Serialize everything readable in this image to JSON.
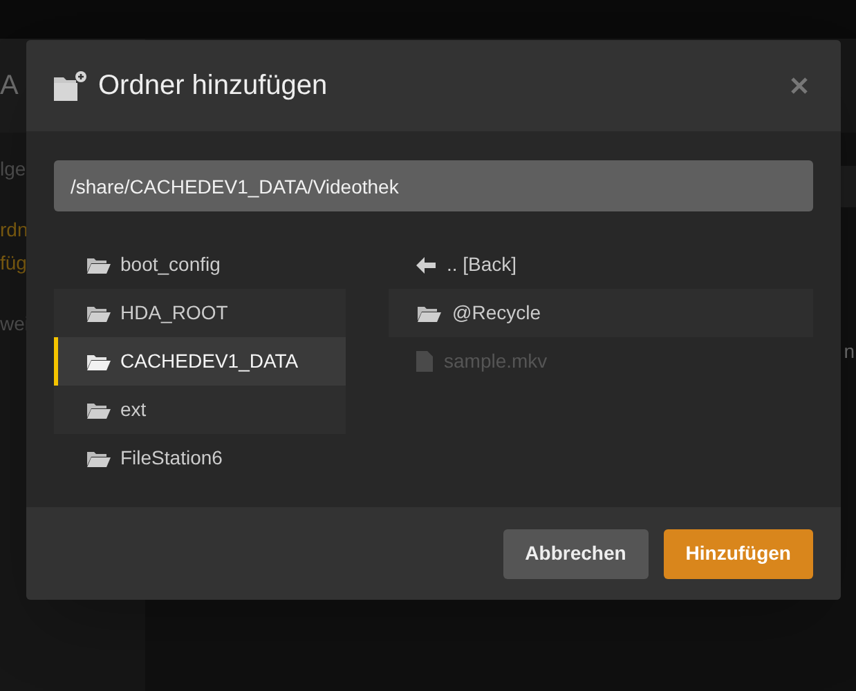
{
  "background": {
    "header": "A",
    "sidebar": [
      {
        "text": "lge",
        "highlighted": false
      },
      {
        "text": "rdn",
        "highlighted": true
      },
      {
        "text": "füg",
        "highlighted": true
      },
      {
        "text": "wei",
        "highlighted": false
      }
    ],
    "main_text": "n"
  },
  "dialog": {
    "title": "Ordner hinzufügen",
    "path": "/share/CACHEDEV1_DATA/Videothek",
    "folders": [
      {
        "name": "boot_config",
        "selected": false
      },
      {
        "name": "HDA_ROOT",
        "selected": false
      },
      {
        "name": "CACHEDEV1_DATA",
        "selected": true
      },
      {
        "name": "ext",
        "selected": false
      },
      {
        "name": "FileStation6",
        "selected": false
      }
    ],
    "contents": [
      {
        "name": ".. [Back]",
        "kind": "back",
        "disabled": false
      },
      {
        "name": "@Recycle",
        "kind": "folder",
        "disabled": false
      },
      {
        "name": "sample.mkv",
        "kind": "file",
        "disabled": true
      }
    ],
    "buttons": [
      {
        "label": "Abbrechen",
        "kind": "secondary"
      },
      {
        "label": "Hinzufügen",
        "kind": "primary"
      }
    ]
  }
}
